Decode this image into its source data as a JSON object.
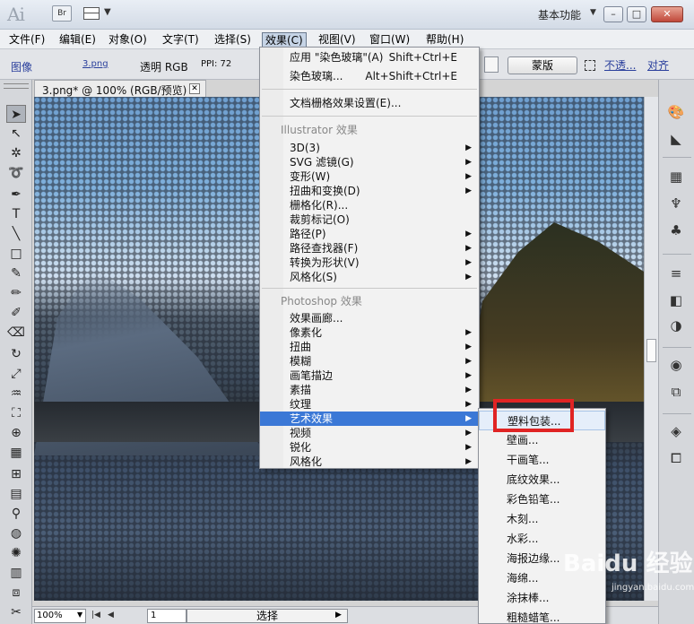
{
  "titlebar": {
    "app_logo": "Ai",
    "bridge_button": "Br",
    "workspace": "基本功能",
    "minimize": "–",
    "maximize": "□",
    "close": "✕"
  },
  "menubar": [
    "文件(F)",
    "编辑(E)",
    "对象(O)",
    "文字(T)",
    "选择(S)",
    "效果(C)",
    "视图(V)",
    "窗口(W)",
    "帮助(H)"
  ],
  "controlbar": {
    "image_label": "图像",
    "file_name": "3.png",
    "transparency": "透明 RGB",
    "ppi": "PPI: 72",
    "mask_button": "蒙版",
    "opacity_link": "不透...",
    "align_link": "对齐"
  },
  "document": {
    "tab_title": "3.png* @ 100% (RGB/预览)",
    "tab_close": "✕"
  },
  "statusbar": {
    "zoom": "100%",
    "page": "1",
    "status_text": "选择",
    "first": "|◀",
    "prev": "◀",
    "next": "▶",
    "last": "▶|"
  },
  "effect_menu": {
    "apply_last": "应用 \"染色玻璃\"(A)",
    "apply_last_shortcut": "Shift+Ctrl+E",
    "last_effect": "染色玻璃...",
    "last_effect_shortcut": "Alt+Shift+Ctrl+E",
    "raster_settings": "文档栅格效果设置(E)...",
    "illustrator_header": "Illustrator 效果",
    "illustrator_items": [
      "3D(3)",
      "SVG 滤镜(G)",
      "变形(W)",
      "扭曲和变换(D)",
      "栅格化(R)...",
      "裁剪标记(O)",
      "路径(P)",
      "路径查找器(F)",
      "转换为形状(V)",
      "风格化(S)"
    ],
    "photoshop_header": "Photoshop 效果",
    "photoshop_items": [
      "效果画廊...",
      "像素化",
      "扭曲",
      "模糊",
      "画笔描边",
      "素描",
      "纹理",
      "艺术效果",
      "视频",
      "锐化",
      "风格化"
    ]
  },
  "art_submenu": {
    "items": [
      "塑料包装...",
      "壁画...",
      "干画笔...",
      "底纹效果...",
      "彩色铅笔...",
      "木刻...",
      "水彩...",
      "海报边缘...",
      "海绵...",
      "涂抹棒...",
      "粗糙蜡笔..."
    ]
  },
  "watermark": {
    "main": "Baidu 经验",
    "sub": "jingyan.baidu.com"
  },
  "colors": {
    "highlight": "#3b78d6",
    "annotation_red": "#e02424"
  }
}
